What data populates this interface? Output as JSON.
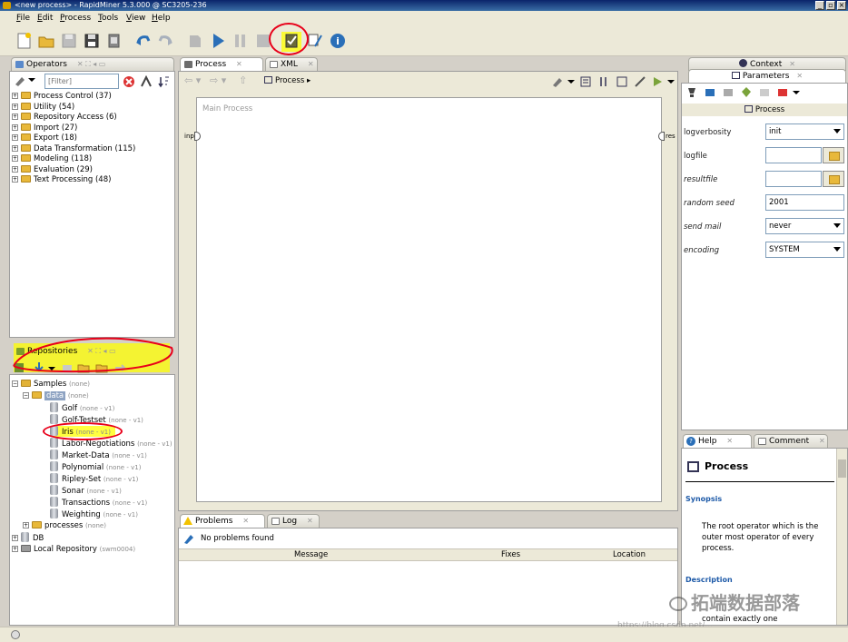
{
  "window": {
    "title": "<new process> - RapidMiner 5.3.000 @ SC3205-236"
  },
  "menu": [
    "File",
    "Edit",
    "Process",
    "Tools",
    "View",
    "Help"
  ],
  "operators": {
    "tab_label": "Operators",
    "filter_placeholder": "[Filter]",
    "items": [
      "Process Control (37)",
      "Utility (54)",
      "Repository Access (6)",
      "Import (27)",
      "Export (18)",
      "Data Transformation (115)",
      "Modeling (118)",
      "Evaluation (29)",
      "Text Processing (48)"
    ]
  },
  "repositories": {
    "tab_label": "Repositories",
    "samples": {
      "label": "Samples",
      "note": "(none)"
    },
    "data": {
      "label": "data",
      "note": "(none)"
    },
    "entries": [
      {
        "label": "Golf",
        "note": "(none - v1)"
      },
      {
        "label": "Golf-Testset",
        "note": "(none - v1)"
      },
      {
        "label": "Iris",
        "note": "(none - v1)"
      },
      {
        "label": "Labor-Negotiations",
        "note": "(none - v1)"
      },
      {
        "label": "Market-Data",
        "note": "(none - v1)"
      },
      {
        "label": "Polynomial",
        "note": "(none - v1)"
      },
      {
        "label": "Ripley-Set",
        "note": "(none - v1)"
      },
      {
        "label": "Sonar",
        "note": "(none - v1)"
      },
      {
        "label": "Transactions",
        "note": "(none - v1)"
      },
      {
        "label": "Weighting",
        "note": "(none - v1)"
      }
    ],
    "processes": {
      "label": "processes",
      "note": "(none)"
    },
    "db": {
      "label": "DB"
    },
    "local": {
      "label": "Local Repository",
      "note": "(swm0004)"
    }
  },
  "process_view": {
    "tabs": [
      "Process",
      "XML"
    ],
    "breadcrumb": "Process",
    "canvas_title": "Main Process",
    "port_in": "inp",
    "port_out": "res"
  },
  "problems": {
    "tabs": [
      "Problems",
      "Log"
    ],
    "status": "No problems found",
    "columns": [
      "Message",
      "Fixes",
      "Location"
    ]
  },
  "context": {
    "tab_label": "Context"
  },
  "parameters": {
    "tab_label": "Parameters",
    "operator": "Process",
    "rows": [
      {
        "label": "logverbosity",
        "value": "init",
        "kind": "select"
      },
      {
        "label": "logfile",
        "value": "",
        "kind": "file"
      },
      {
        "label": "resultfile",
        "value": "",
        "kind": "file"
      },
      {
        "label": "random seed",
        "value": "2001",
        "kind": "text"
      },
      {
        "label": "send mail",
        "value": "never",
        "kind": "select"
      },
      {
        "label": "encoding",
        "value": "SYSTEM",
        "kind": "select"
      }
    ]
  },
  "help": {
    "tabs": [
      "Help",
      "Comment"
    ],
    "title": "Process",
    "synopsis_heading": "Synopsis",
    "synopsis": "The root operator which is the outer most operator of every process.",
    "description_heading": "Description",
    "description_partial": "contain exactly one"
  },
  "watermark": {
    "text": "拓端数据部落",
    "url": "https://blog.csdn.net/..."
  },
  "colors": {
    "highlight": "#ffff00",
    "annotation": "#e8001a",
    "link": "#1e5aa8"
  }
}
